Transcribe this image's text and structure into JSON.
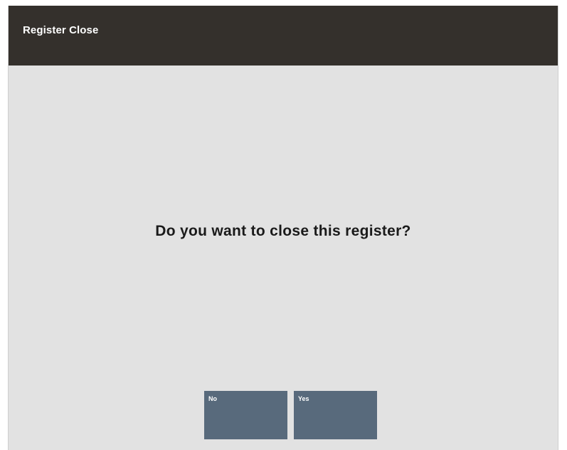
{
  "window": {
    "title": "Register Close"
  },
  "dialog": {
    "prompt": "Do you want to close this register?"
  },
  "buttons": {
    "no_label": "No",
    "yes_label": "Yes"
  },
  "colors": {
    "title_bar": "#34302c",
    "background": "#e2e2e2",
    "button": "#586a7c",
    "button_text": "#ffffff",
    "prompt_text": "#1a1a1a"
  }
}
